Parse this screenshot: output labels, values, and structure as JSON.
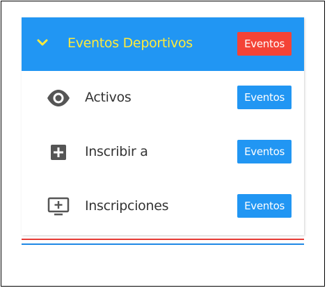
{
  "menu": {
    "header": {
      "icon": "chevron-down-icon",
      "title": "Eventos Deportivos",
      "badge": "Eventos",
      "colors": {
        "background": "#2196f3",
        "title": "#ffeb3b",
        "badge": "#f44336"
      }
    },
    "items": [
      {
        "icon": "eye-icon",
        "label": "Activos",
        "badge": "Eventos"
      },
      {
        "icon": "plus-square-icon",
        "label": "Inscribir a",
        "badge": "Eventos"
      },
      {
        "icon": "monitor-plus-icon",
        "label": "Inscripciones",
        "badge": "Eventos"
      }
    ],
    "badge_color": "#2196f3"
  }
}
